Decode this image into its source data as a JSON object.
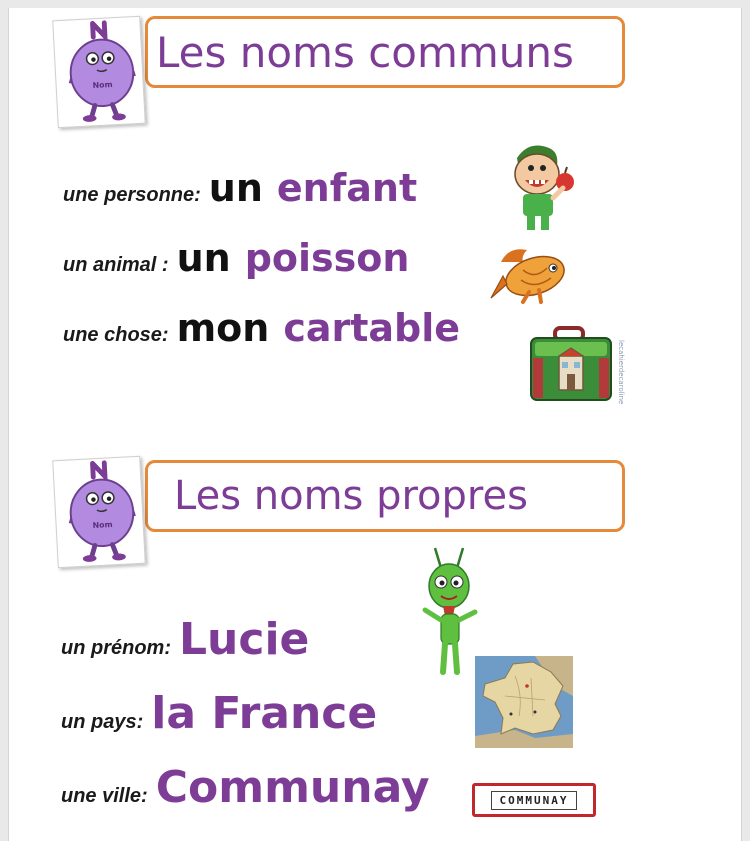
{
  "sections": {
    "common": {
      "title": "Les noms communs",
      "rows": [
        {
          "label": "une personne:",
          "det": "un",
          "noun": "enfant"
        },
        {
          "label": "un animal :",
          "det": "un",
          "noun": "poisson"
        },
        {
          "label": "une chose:",
          "det": "mon",
          "noun": "cartable"
        }
      ]
    },
    "proper": {
      "title": "Les noms propres",
      "rows": [
        {
          "label": "un prénom:",
          "noun": "Lucie"
        },
        {
          "label": "un pays:",
          "noun": "la France"
        },
        {
          "label": "une ville:",
          "noun": "Communay"
        }
      ]
    }
  },
  "mascot": {
    "letter": "N",
    "badge": "Nom"
  },
  "town_sign": "COMMUNAY",
  "credit": "lecahierdecaroline",
  "colors": {
    "accent_purple": "#7d3d96",
    "frame_orange": "#e58a3b",
    "mascot_purple": "#b28ae0",
    "sign_red": "#c0282d"
  },
  "icons": [
    "mascot-n",
    "child-eating-apple",
    "fish",
    "school-satchel",
    "green-cricket",
    "france-map",
    "town-sign"
  ]
}
